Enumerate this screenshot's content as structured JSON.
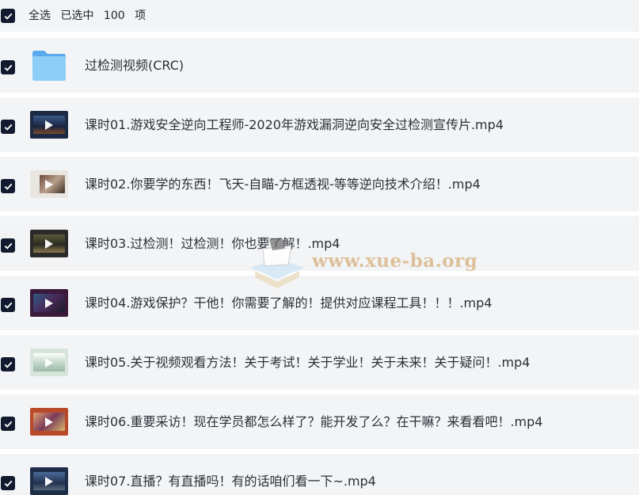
{
  "header": {
    "select_all_label": "全选",
    "selected_label": "已选中",
    "selected_count": "100",
    "count_unit": "项"
  },
  "items": [
    {
      "name": "过检测视频(CRC)",
      "kind": "folder"
    },
    {
      "name": "课时01.游戏安全逆向工程师-2020年游戏漏洞逆向安全过检测宣传片.mp4",
      "kind": "video"
    },
    {
      "name": "课时02.你要学的东西！飞天-自瞄-方框透视-等等逆向技术介绍！.mp4",
      "kind": "video"
    },
    {
      "name": "课时03.过检测！过检测！你也要了解！.mp4",
      "kind": "video"
    },
    {
      "name": "课时04.游戏保护？干他！你需要了解的！提供对应课程工具！！！.mp4",
      "kind": "video"
    },
    {
      "name": "课时05.关于视频观看方法！关于考试！关于学业！关于未来！关于疑问！.mp4",
      "kind": "video"
    },
    {
      "name": "课时06.重要采访！现在学员都怎么样了？能开发了么？在干嘛？来看看吧！.mp4",
      "kind": "video"
    },
    {
      "name": "课时07.直播？有直播吗！有的话咱们看一下~.mp4",
      "kind": "video"
    }
  ],
  "watermark": {
    "text": "www.xue-ba.org"
  },
  "colors": {
    "row_background": "#f3f4f6",
    "checkbox": "#111a2e",
    "folder": "#7cc0f2",
    "watermark": "#d9b88a"
  },
  "icons": {
    "checkbox": "checkbox-checked-icon",
    "folder": "folder-icon",
    "video": "video-thumbnail-play-icon"
  }
}
